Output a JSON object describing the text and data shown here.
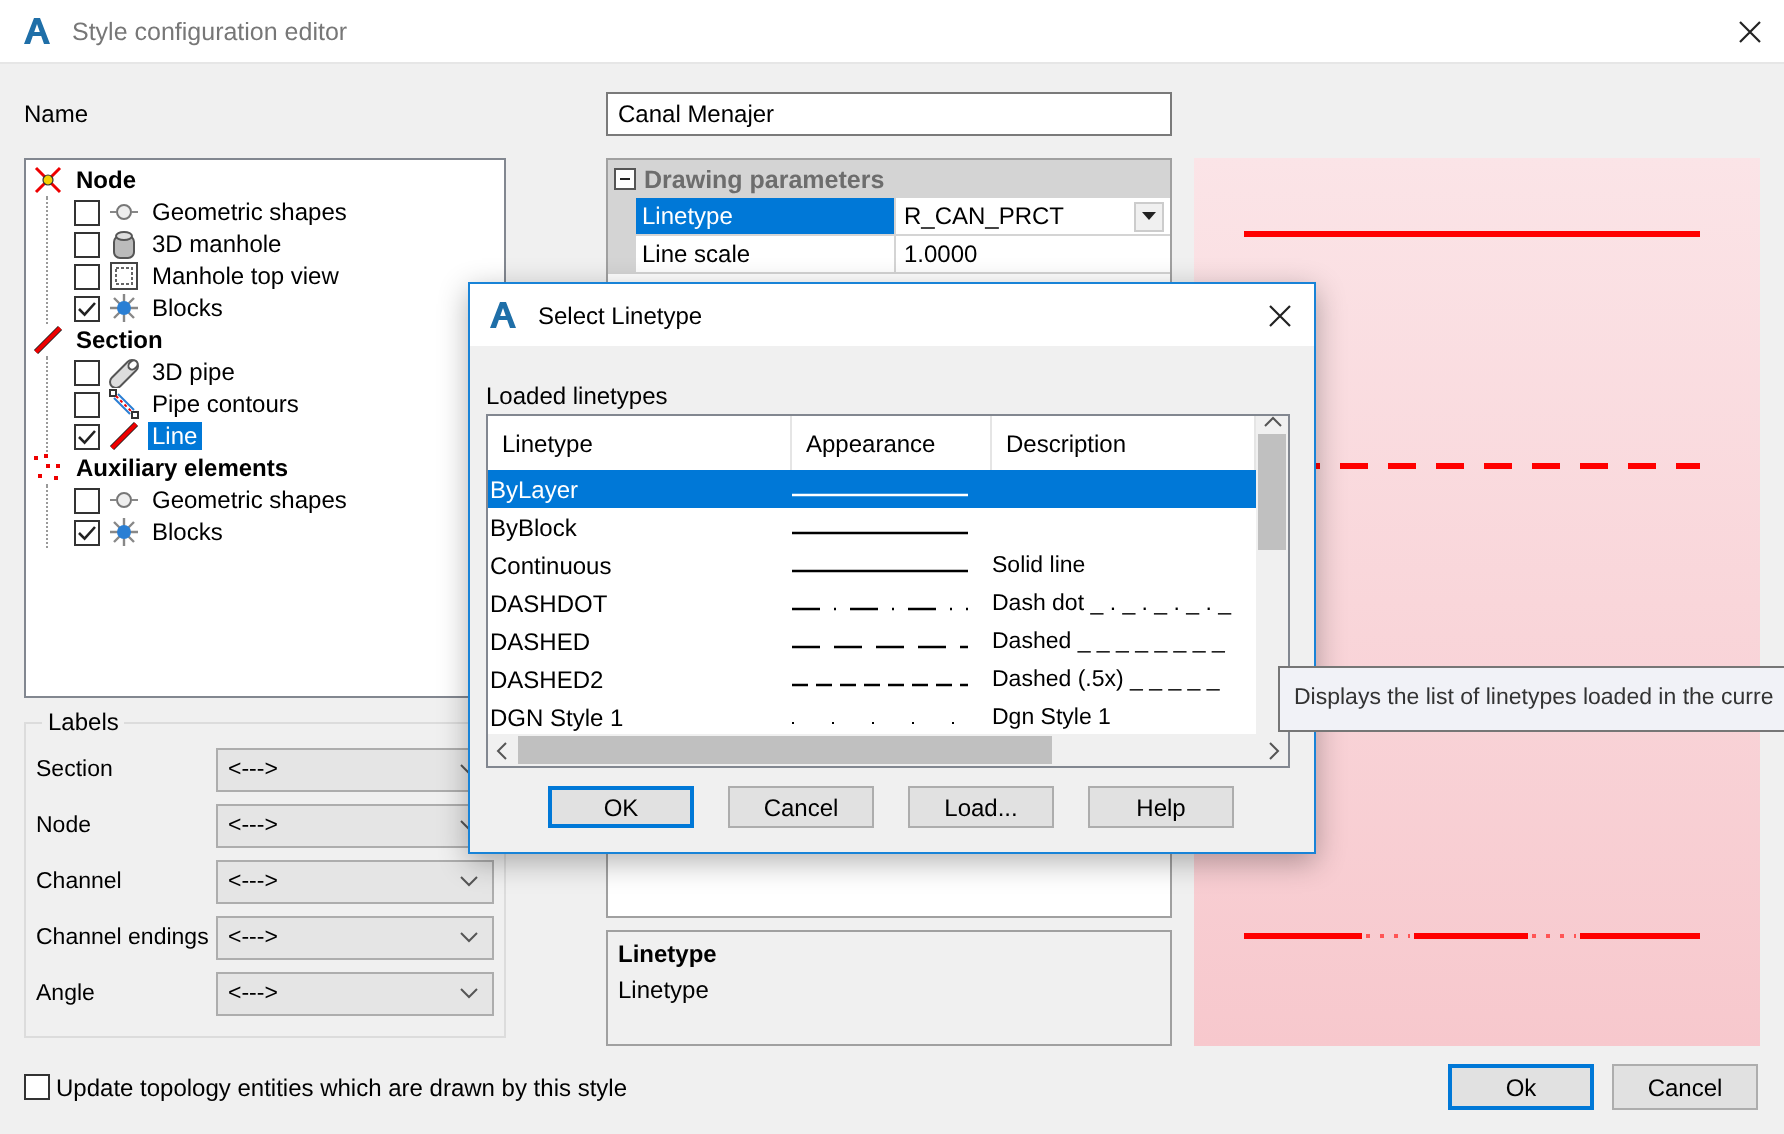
{
  "window": {
    "title": "Style configuration editor"
  },
  "name_field": {
    "label": "Name",
    "value": "Canal Menajer"
  },
  "tree": {
    "items": [
      {
        "label": "Node",
        "kind": "node",
        "selected": false,
        "children": [
          {
            "label": "Geometric shapes",
            "kind": "geometric",
            "checked": false,
            "selected": false
          },
          {
            "label": "3D manhole",
            "kind": "manhole3d",
            "checked": false,
            "selected": false
          },
          {
            "label": "Manhole top view",
            "kind": "manholetop",
            "checked": false,
            "selected": false
          },
          {
            "label": "Blocks",
            "kind": "blocks",
            "checked": true,
            "selected": false
          }
        ]
      },
      {
        "label": "Section",
        "kind": "section",
        "selected": false,
        "children": [
          {
            "label": "3D pipe",
            "kind": "pipe3d",
            "checked": false,
            "selected": false
          },
          {
            "label": "Pipe contours",
            "kind": "contours",
            "checked": false,
            "selected": false
          },
          {
            "label": "Line",
            "kind": "line",
            "checked": true,
            "selected": true
          }
        ]
      },
      {
        "label": "Auxiliary elements",
        "kind": "auxiliary",
        "selected": false,
        "children": [
          {
            "label": "Geometric shapes",
            "kind": "geometric",
            "checked": false,
            "selected": false
          },
          {
            "label": "Blocks",
            "kind": "blocks",
            "checked": true,
            "selected": false
          }
        ]
      }
    ]
  },
  "labels": {
    "title": "Labels",
    "rows": [
      {
        "label": "Section",
        "value": "<--->"
      },
      {
        "label": "Node",
        "value": "<--->"
      },
      {
        "label": "Channel",
        "value": "<--->"
      },
      {
        "label": "Channel endings",
        "value": "<--->"
      },
      {
        "label": "Angle",
        "value": "<--->"
      }
    ]
  },
  "property_grid": {
    "category": {
      "label": "Drawing parameters",
      "expanded": true
    },
    "rows": [
      {
        "name": "Linetype",
        "value": "R_CAN_PRCT",
        "kind": "dropdown",
        "selected": true
      },
      {
        "name": "Line scale",
        "value": "1.0000",
        "kind": "text",
        "selected": false
      }
    ]
  },
  "description": {
    "title": "Linetype",
    "text": "Linetype"
  },
  "preview": {
    "lines": [
      {
        "kind": "solid"
      },
      {
        "kind": "dashed"
      },
      {
        "kind": "dashdotdot"
      }
    ]
  },
  "update_checkbox": {
    "label": "Update topology entities which are drawn by this style",
    "checked": false
  },
  "buttons": [
    {
      "label": "Ok",
      "focused": true
    },
    {
      "label": "Cancel",
      "focused": false
    }
  ],
  "dialog": {
    "title": "Select Linetype",
    "list_label": "Loaded linetypes",
    "columns": [
      "Linetype",
      "Appearance",
      "Description"
    ],
    "rows": [
      {
        "linetype": "ByLayer",
        "kind": "solid",
        "selected": true
      },
      {
        "linetype": "ByBlock",
        "kind": "solid",
        "selected": false
      },
      {
        "linetype": "Continuous",
        "kind": "solid",
        "description": "Solid line",
        "selected": false
      },
      {
        "linetype": "DASHDOT",
        "kind": "dashdot",
        "description": "Dash dot _ . _ . _ . _ . _",
        "selected": false
      },
      {
        "linetype": "DASHED",
        "kind": "dashed",
        "description": "Dashed _ _ _ _ _ _ _ _",
        "selected": false
      },
      {
        "linetype": "DASHED2",
        "kind": "dashed2",
        "description": "Dashed (.5x) _ _ _ _ _",
        "selected": false
      },
      {
        "linetype": "DGN Style 1",
        "kind": "dots",
        "description": "Dgn Style 1",
        "selected": false
      }
    ],
    "buttons": [
      {
        "label": "OK",
        "focused": true
      },
      {
        "label": "Cancel",
        "focused": false
      },
      {
        "label": "Load...",
        "focused": false
      },
      {
        "label": "Help",
        "focused": false
      }
    ]
  },
  "tooltip": {
    "text": "Displays the list of linetypes loaded in the curre"
  }
}
